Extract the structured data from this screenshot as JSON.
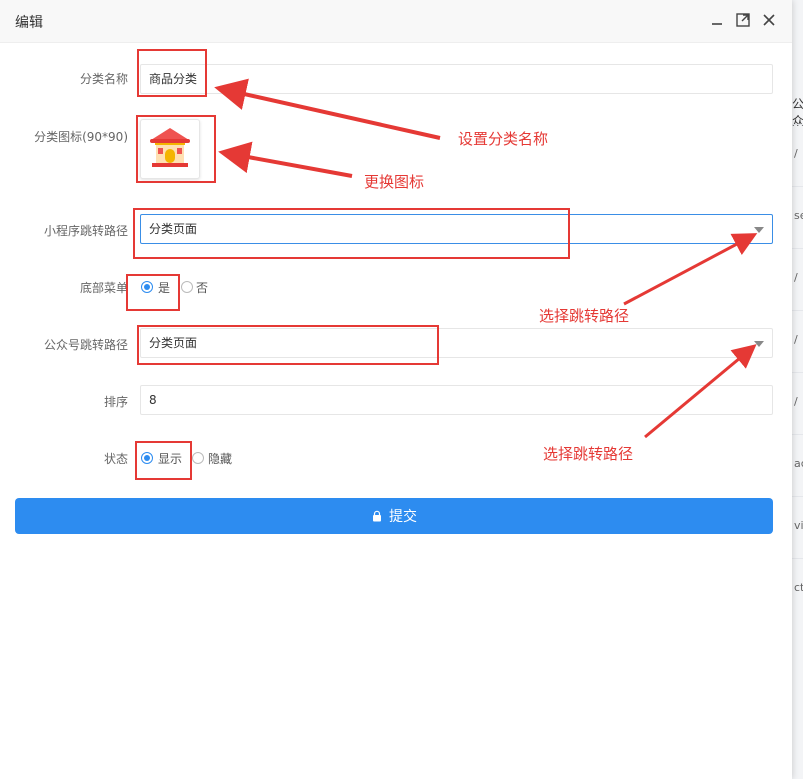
{
  "dialog": {
    "title": "编辑"
  },
  "form": {
    "category_name_label": "分类名称",
    "category_name_value": "商品分类",
    "category_icon_label": "分类图标(90*90)",
    "mini_program_path_label": "小程序跳转路径",
    "mini_program_path_value": "分类页面",
    "bottom_menu_label": "底部菜单",
    "bottom_menu_options": [
      "是",
      "否"
    ],
    "bottom_menu_selected": "是",
    "official_account_path_label": "公众号跳转路径",
    "official_account_path_value": "分类页面",
    "sort_label": "排序",
    "sort_value": "8",
    "status_label": "状态",
    "status_options": [
      "显示",
      "隐藏"
    ],
    "status_selected": "显示",
    "submit_label": "提交"
  },
  "annotations": {
    "set_name": "设置分类名称",
    "change_icon": "更换图标",
    "select_path_1": "选择跳转路径",
    "select_path_2": "选择跳转路径"
  },
  "background": {
    "header_fragment": "公众",
    "cells": [
      "/",
      "se",
      "/",
      "/",
      "/",
      "ac",
      "vit",
      "ct"
    ]
  },
  "colors": {
    "accent": "#2d8cf0",
    "annotation": "#e53935"
  }
}
